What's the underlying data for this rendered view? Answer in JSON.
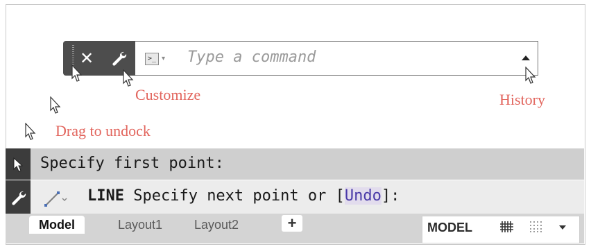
{
  "command_line": {
    "placeholder": "Type a command",
    "prompt_glyph": ">_",
    "caret_glyph": "▾",
    "close_glyph": "✕"
  },
  "annotations": {
    "customize": "Customize",
    "history": "History",
    "drag_to_undock": "Drag to undock"
  },
  "docked": {
    "history_line": "Specify first point:",
    "active_command": "LINE",
    "active_prompt_before": " Specify next point or [",
    "option": "Undo",
    "active_prompt_after": "]:"
  },
  "layout_tabs": {
    "tabs": [
      {
        "label": "Model",
        "active": true
      },
      {
        "label": "Layout1",
        "active": false
      },
      {
        "label": "Layout2",
        "active": false
      }
    ],
    "add_label": "+"
  },
  "status": {
    "model_label": "MODEL"
  },
  "colors": {
    "annotation": "#e2655d",
    "toolbar_dark": "#4d4d4d",
    "option_highlight": "#4a3aa8"
  },
  "icons": [
    "close-icon",
    "wrench-icon",
    "command-prompt-icon",
    "history-arrow-icon",
    "cursor-icon",
    "line-icon",
    "grid-icon",
    "snap-icon"
  ]
}
